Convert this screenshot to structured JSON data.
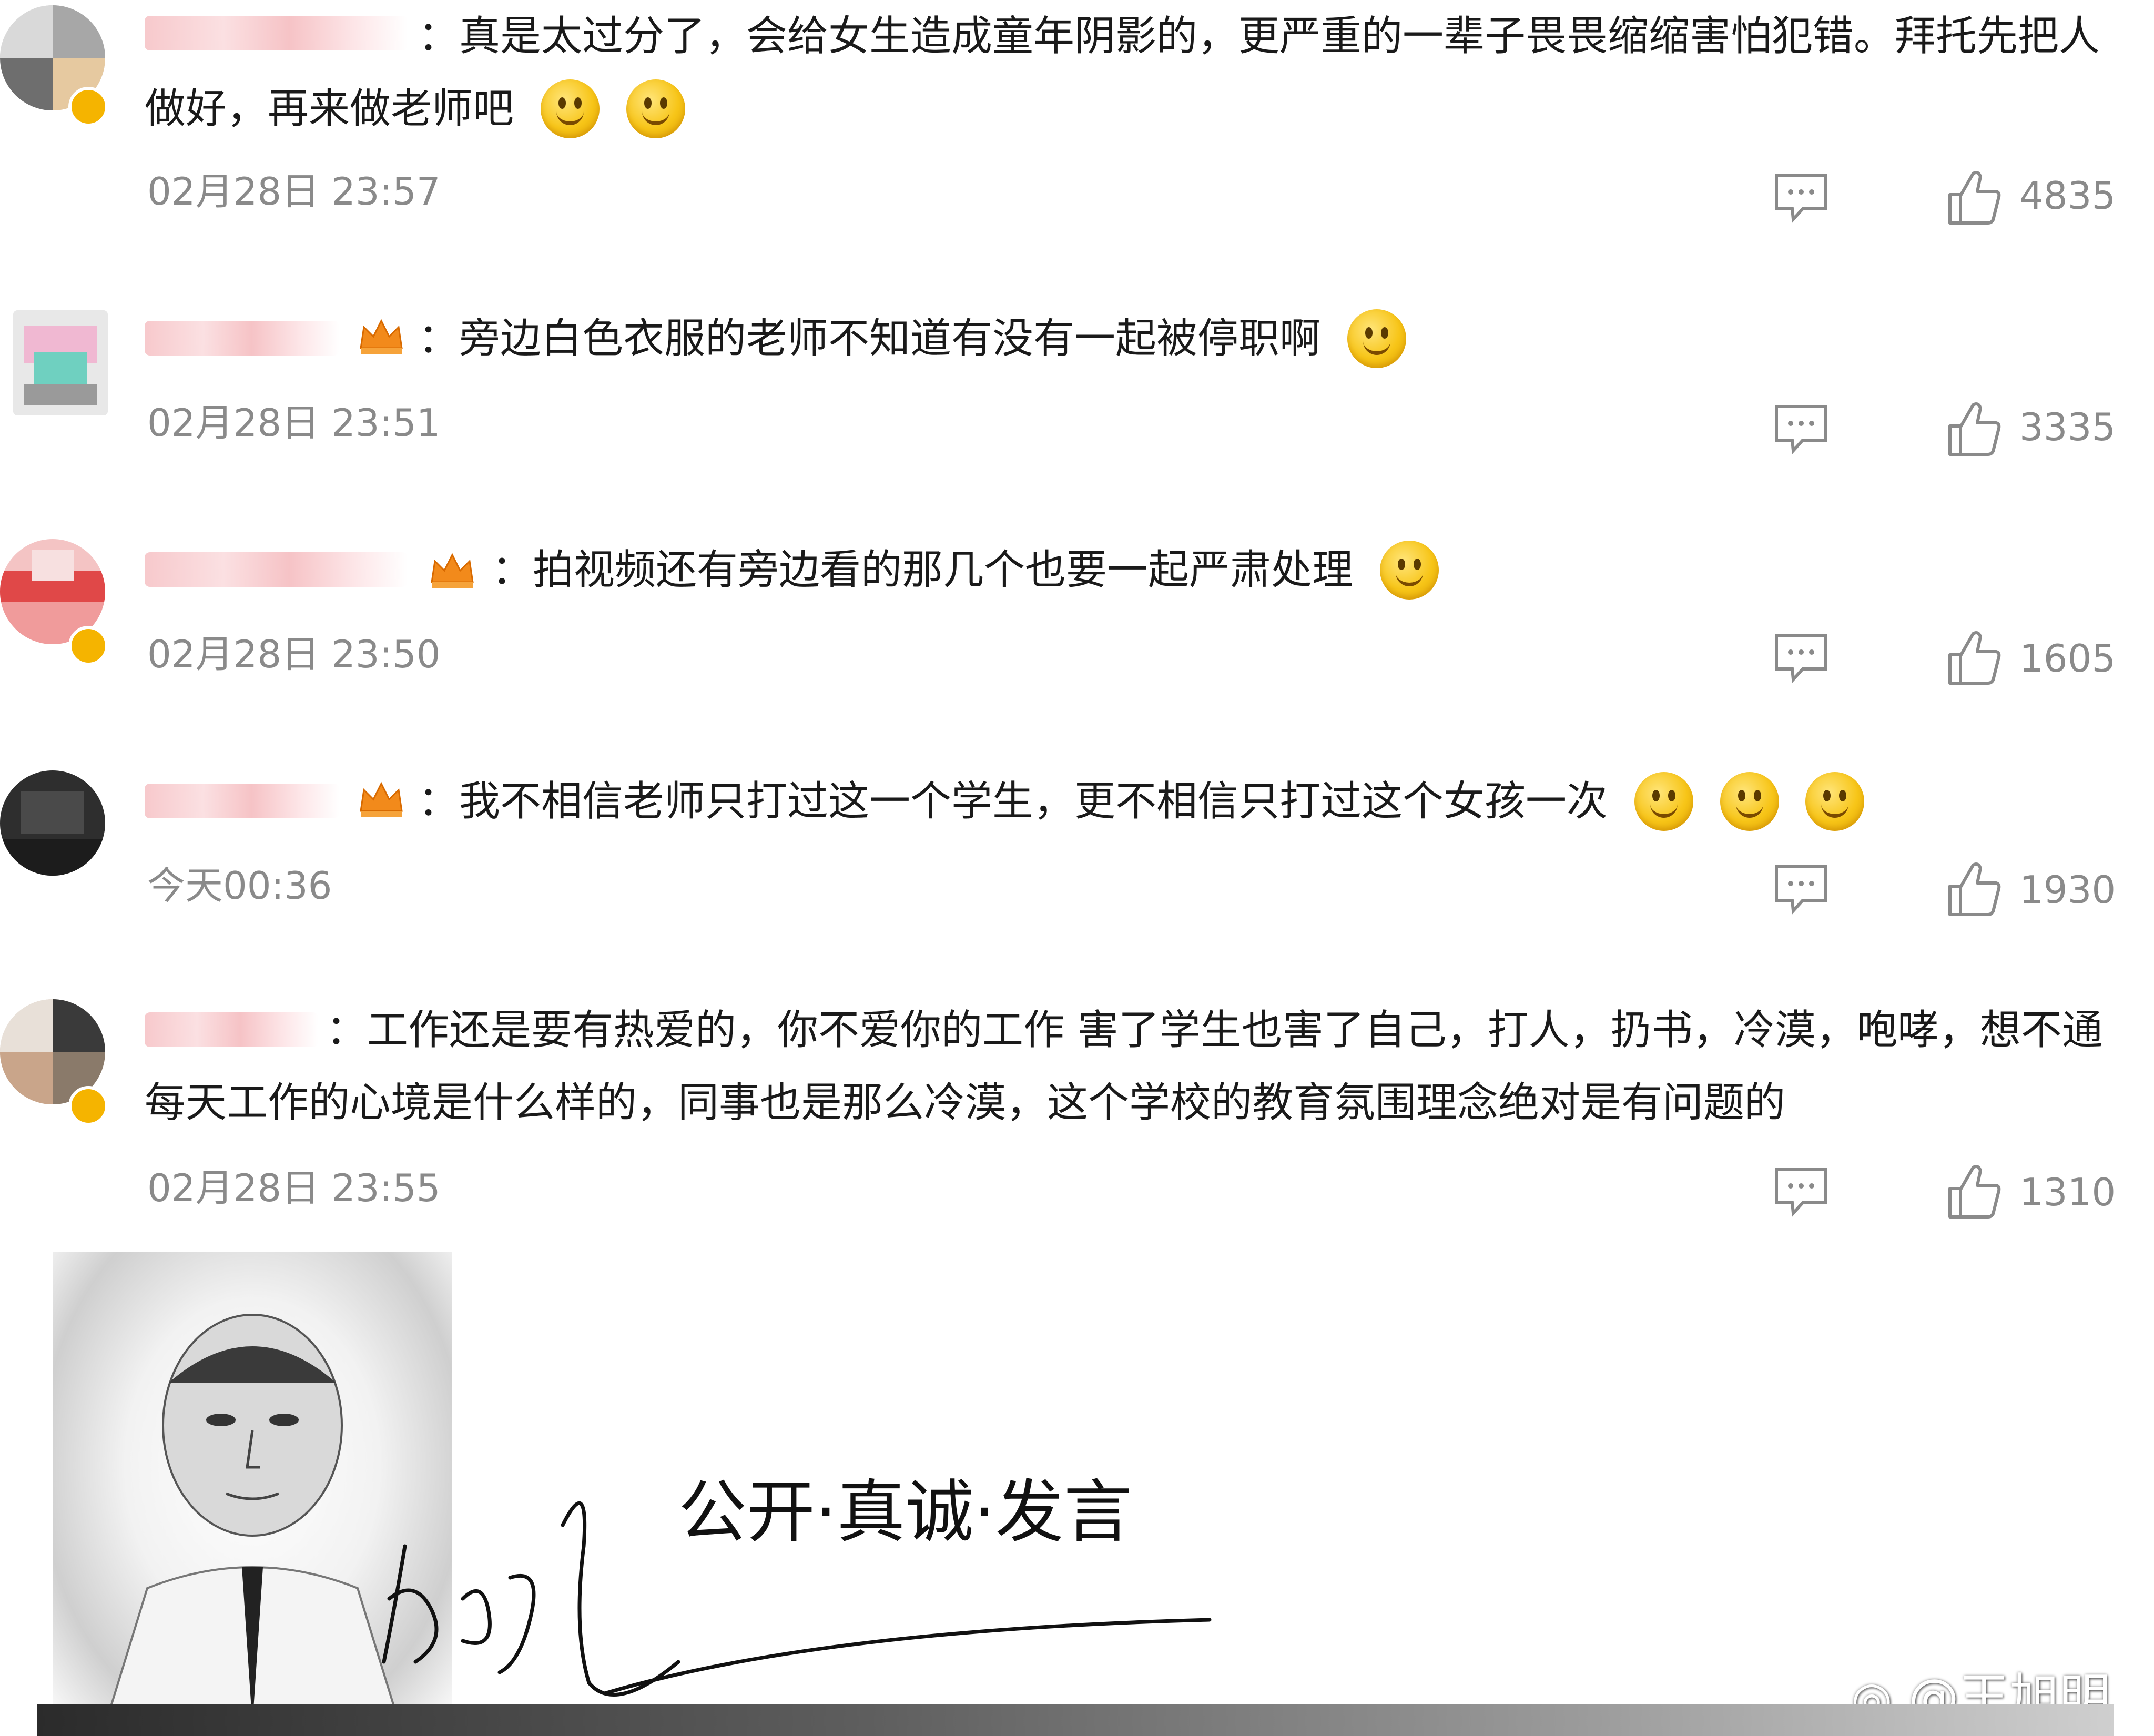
{
  "comments": [
    {
      "text": "：真是太过分了，会给女生造成童年阴影的，更严重的一辈子畏畏缩缩害怕犯错。拜托先把人做好，再来做老师吧",
      "time": "02月28日 23:57",
      "likes": "4835",
      "has_crown": false,
      "emojis": [
        "doge-thinking",
        "doge-thinking"
      ]
    },
    {
      "text": "：旁边白色衣服的老师不知道有没有一起被停职啊",
      "time": "02月28日 23:51",
      "likes": "3335",
      "has_crown": true,
      "emojis": [
        "peek-eyes"
      ]
    },
    {
      "text": "：拍视频还有旁边看的那几个也要一起严肃处理",
      "time": "02月28日 23:50",
      "likes": "1605",
      "has_crown": true,
      "emojis": [
        "smile"
      ]
    },
    {
      "text": "：我不相信老师只打过这一个学生，更不相信只打过这个女孩一次",
      "time": "今天00:36",
      "likes": "1930",
      "has_crown": true,
      "emojis": [
        "smile",
        "smile",
        "smile"
      ]
    },
    {
      "text": "：工作还是要有热爱的，你不爱你的工作 害了学生也害了自己，打人，扔书，冷漠，咆哮，想不通每天工作的心境是什么样的，同事也是那么冷漠，这个学校的教育氛围理念绝对是有问题的",
      "time": "02月28日 23:55",
      "likes": "1310",
      "has_crown": false,
      "emojis": []
    }
  ],
  "icons": {
    "reply": "comment-bubble-icon",
    "like": "thumbs-up-icon",
    "crown": "crown-badge-icon"
  },
  "banner": {
    "slogan": "公开·真诚·发言",
    "watermark": "@王旭明"
  },
  "colors": {
    "meta_gray": "#8a8a8a",
    "text": "#1a1a1a",
    "emoji_yellow": "#f7c518",
    "crown_orange": "#f28a1b"
  }
}
